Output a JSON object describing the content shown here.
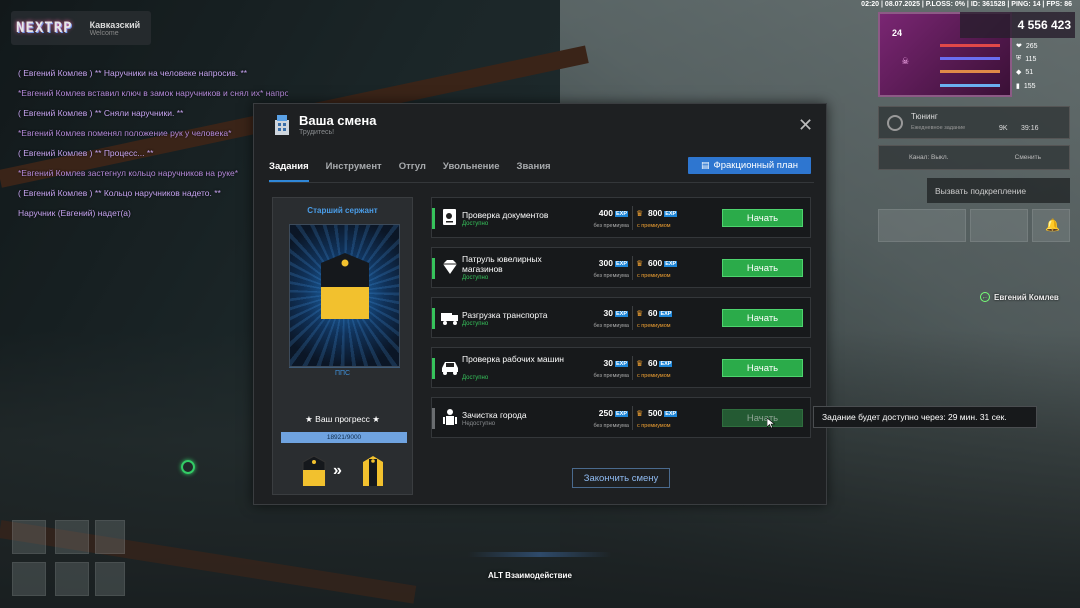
{
  "hud": {
    "logo": "NEXTRP",
    "server_name": "Кавказский",
    "server_sub": "Welcome",
    "status_line": "02:20 | 08.07.2025 | P.LOSS: 0% | ID: 361528 | PING: 14 | FPS: 86",
    "money": "4 556 423",
    "level": "24",
    "stats": [
      "265",
      "115",
      "51",
      "155"
    ],
    "tuning_title": "Тюнинг",
    "tuning_desc": "Ежедневное задание",
    "tuning_count": "9K",
    "tuning_time": "39:16",
    "radio_label": "Канал: Выкл.",
    "radio_switch": "Сменить",
    "backup_label": "Вызвать подкрепление",
    "npc_name": "Евгений Комлев",
    "interact_hint": "ALT Взаимодействие",
    "chat": [
      "( Евгений Комлев ) ** Наручники на человеке напросив. **",
      "*Евгений Комлев вставил ключ в замок наручников и снял их* напротив",
      "( Евгений Комлев ) ** Сняли наручники. **",
      "*Евгений Комлев поменял положение рук у человека*",
      "( Евгений Комлев ) ** Процесс... **",
      "*Евгений Комлев застегнул кольцо наручников на руке*",
      "( Евгений Комлев ) ** Кольцо наручников надето. **",
      "Наручник (Евгений) надет(а)"
    ]
  },
  "modal": {
    "title": "Ваша смена",
    "subtitle": "Трудитесь!",
    "tabs": [
      "Задания",
      "Инструмент",
      "Отгул",
      "Увольнение",
      "Звания"
    ],
    "faction_plan": "Фракционный план",
    "rank_title": "Старший сержант",
    "rank_unit": "ППС",
    "progress_title": "★ Ваш прогресс ★",
    "progress_text": "18921/9000",
    "progress_fraction": 1.0,
    "finish_label": "Закончить смену",
    "tooltip": "Задание будет доступно через: 29 мин. 31 сек.",
    "exp_tag": "EXP",
    "no_premium": "без премиума",
    "with_premium": "с премиумом",
    "tasks": [
      {
        "name": "Проверка документов",
        "status": "Доступно",
        "exp": "400",
        "exp_premium": "800",
        "button": "Начать",
        "available": true
      },
      {
        "name": "Патруль ювелирных магазинов",
        "status": "Доступно",
        "exp": "300",
        "exp_premium": "600",
        "button": "Начать",
        "available": true
      },
      {
        "name": "Разгрузка транспорта",
        "status": "Доступно",
        "exp": "30",
        "exp_premium": "60",
        "button": "Начать",
        "available": true
      },
      {
        "name": "Проверка рабочих машин",
        "status": "Доступно",
        "exp": "30",
        "exp_premium": "60",
        "button": "Начать",
        "available": true
      },
      {
        "name": "Зачистка города",
        "status": "Недоступно",
        "exp": "250",
        "exp_premium": "500",
        "button": "Начать",
        "available": false
      }
    ]
  },
  "colors": {
    "accent": "#2e76d0",
    "green": "#2bab4a",
    "gold": "#f2a232"
  }
}
